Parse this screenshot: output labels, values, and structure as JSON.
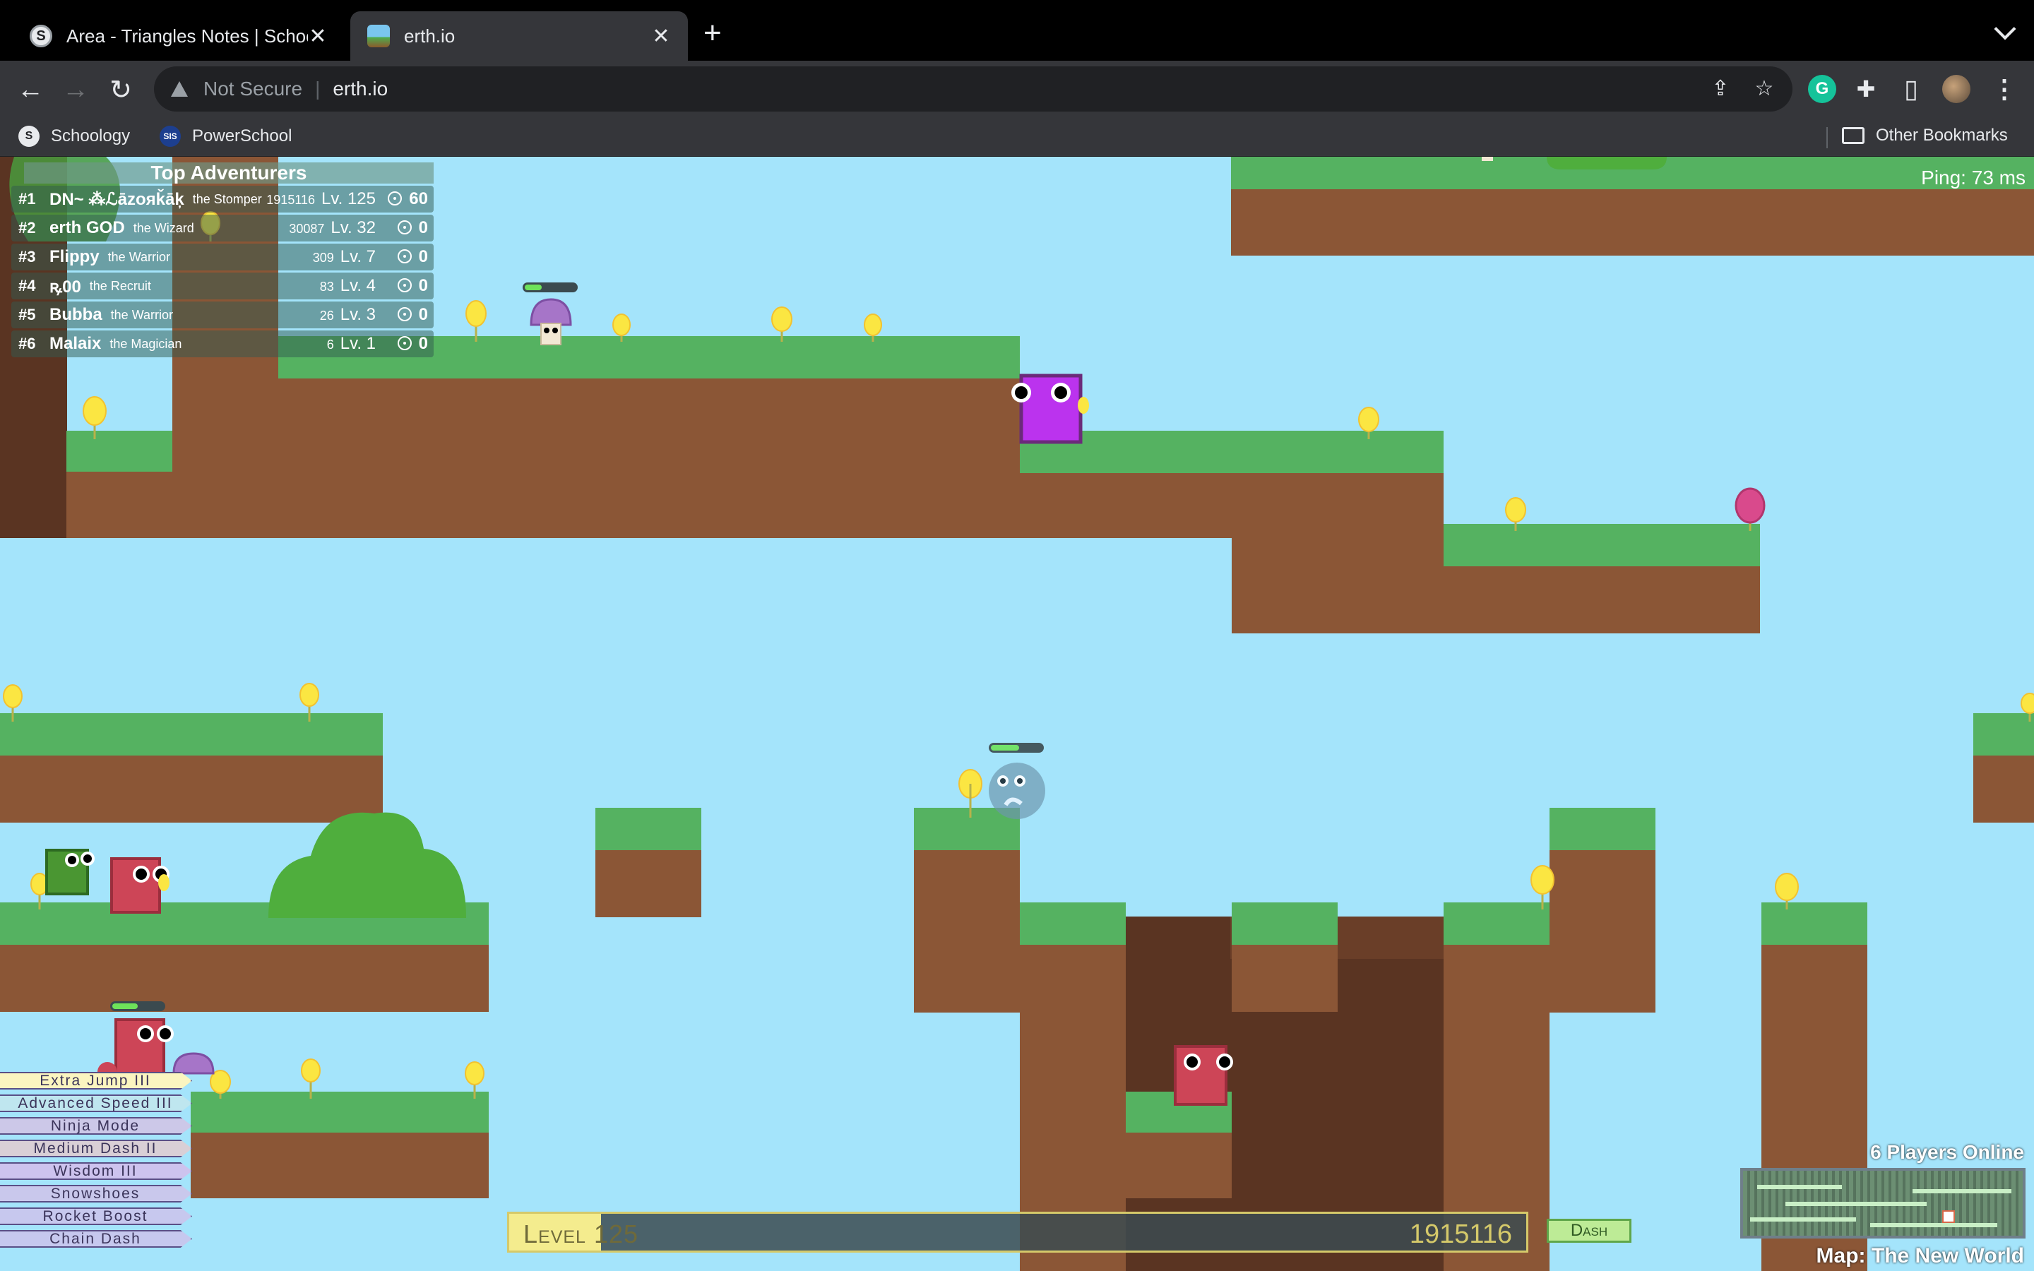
{
  "browser": {
    "tabs": [
      {
        "title": "Area - Triangles Notes | Schoology",
        "active": false
      },
      {
        "title": "erth.io",
        "active": true
      }
    ],
    "address": {
      "security_label": "Not Secure",
      "url": "erth.io"
    },
    "bookmarks": [
      {
        "label": "Schoology",
        "icon": "schoology-icon"
      },
      {
        "label": "PowerSchool",
        "icon": "powerschool-icon"
      }
    ],
    "other_bookmarks": "Other Bookmarks",
    "icons": {
      "back": "←",
      "forward": "→",
      "reload": "↻",
      "share": "⇪",
      "star": "☆",
      "new_tab": "+",
      "close": "✕",
      "puzzle": "✚",
      "sidebar": "▯",
      "menu": "⋮",
      "sis": "SIS",
      "s": "S",
      "g": "G"
    }
  },
  "game": {
    "leaderboard": {
      "title": "Top Adventurers",
      "rows": [
        {
          "rank": "#1",
          "name": "DN~ ⁂ℒāzoяǩāķ",
          "title": "the Stomper",
          "score": "1915116",
          "level": "Lv. 125",
          "kills": "60"
        },
        {
          "rank": "#2",
          "name": "erth GOD",
          "title": "the Wizard",
          "score": "30087",
          "level": "Lv. 32",
          "kills": "0"
        },
        {
          "rank": "#3",
          "name": "Flippy",
          "title": "the Warrior",
          "score": "309",
          "level": "Lv. 7",
          "kills": "0"
        },
        {
          "rank": "#4",
          "name": "ꝶ00",
          "title": "the Recruit",
          "score": "83",
          "level": "Lv. 4",
          "kills": "0"
        },
        {
          "rank": "#5",
          "name": "Bubba",
          "title": "the Warrior",
          "score": "26",
          "level": "Lv. 3",
          "kills": "0"
        },
        {
          "rank": "#6",
          "name": "Malaix",
          "title": "the Magician",
          "score": "6",
          "level": "Lv. 1",
          "kills": "0"
        }
      ]
    },
    "ping": "Ping: 73 ms",
    "upgrades": [
      {
        "label": "Extra Jump III",
        "color": "#fbf5c0"
      },
      {
        "label": "Advanced Speed III",
        "color": "#bfe6ef"
      },
      {
        "label": "Ninja Mode",
        "color": "#ccc8e8"
      },
      {
        "label": "Medium Dash II",
        "color": "#d9cfd6"
      },
      {
        "label": "Wisdom III",
        "color": "#cdc3ee"
      },
      {
        "label": "Snowshoes",
        "color": "#c9c8ec"
      },
      {
        "label": "Rocket Boost",
        "color": "#c7c8ee"
      },
      {
        "label": "Chain Dash",
        "color": "#c6c8ee"
      }
    ],
    "xp": {
      "label": "Level 125",
      "value": "1915116",
      "fill_fraction": 0.09
    },
    "dash_button": "Dash",
    "players_online": "6 Players Online",
    "map_name": "Map: The New World",
    "colors": {
      "sky": "#a4e4fb",
      "grass": "#55b261",
      "dirt": "#8b5636",
      "dark_dirt": "#5a3422",
      "flower": "#fbe642",
      "red_enemy": "#cd4557",
      "purple_player": "#bb33ee"
    }
  }
}
